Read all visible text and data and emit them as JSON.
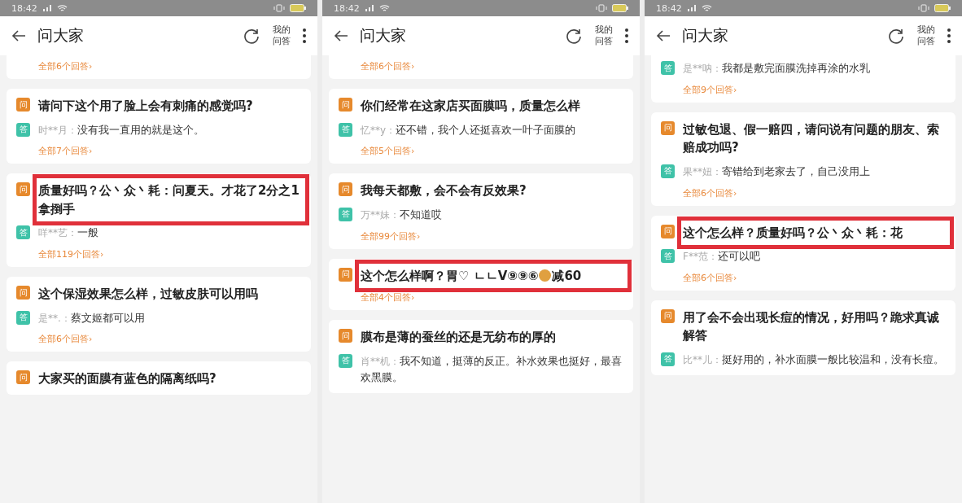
{
  "panels": [
    {
      "status_bar": {
        "time": "18:42"
      },
      "header": {
        "title": "问大家",
        "my_qa": "我的问答"
      },
      "cards": [
        {
          "more_link": "全部6个回答›"
        },
        {
          "question": {
            "badge": "问",
            "text": "请问下这个用了脸上会有刺痛的感觉吗?",
            "highlighted": false
          },
          "answers": [
            {
              "badge": "答",
              "user": "时**月：",
              "text": "没有我一直用的就是这个。"
            }
          ],
          "more_link": "全部7个回答›"
        },
        {
          "question": {
            "badge": "问",
            "text": "质量好吗？公丶众丶耗：问夏天。才花了2分之1拿捯手",
            "highlighted": true
          },
          "answers": [
            {
              "badge": "答",
              "user": "咩**艺：",
              "text": "一般"
            }
          ],
          "more_link": "全部119个回答›"
        },
        {
          "question": {
            "badge": "问",
            "text": "这个保湿效果怎么样，过敏皮肤可以用吗",
            "highlighted": false
          },
          "answers": [
            {
              "badge": "答",
              "user": "是**.：",
              "text": "蔡文姬都可以用"
            }
          ],
          "more_link": "全部6个回答›"
        },
        {
          "question": {
            "badge": "问",
            "text": "大家买的面膜有蓝色的隔离纸吗?",
            "highlighted": false
          }
        }
      ]
    },
    {
      "status_bar": {
        "time": "18:42"
      },
      "header": {
        "title": "问大家",
        "my_qa": "我的问答"
      },
      "cards": [
        {
          "more_link": "全部6个回答›"
        },
        {
          "question": {
            "badge": "问",
            "text": "你们经常在这家店买面膜吗，质量怎么样",
            "highlighted": false
          },
          "answers": [
            {
              "badge": "答",
              "user": "忆**y：",
              "text": "还不错，我个人还挺喜欢一叶子面膜的"
            }
          ],
          "more_link": "全部5个回答›"
        },
        {
          "question": {
            "badge": "问",
            "text": "我每天都敷，会不会有反效果?",
            "highlighted": false
          },
          "answers": [
            {
              "badge": "答",
              "user": "万**妹：",
              "text": "不知道哎"
            }
          ],
          "more_link": "全部99个回答›"
        },
        {
          "question": {
            "badge": "问",
            "text": "这个怎么样啊？胃♡ ㄴㄴV⑨⑨⑥",
            "coin_suffix": "减60",
            "highlighted": true
          },
          "more_link": "全部4个回答›"
        },
        {
          "question": {
            "badge": "问",
            "text": "膜布是薄的蚕丝的还是无纺布的厚的",
            "highlighted": false
          },
          "answers": [
            {
              "badge": "答",
              "user": "肖**机：",
              "text": "我不知道，挺薄的反正。补水效果也挺好，最喜欢黑膜。"
            }
          ]
        }
      ]
    },
    {
      "status_bar": {
        "time": "18:42"
      },
      "header": {
        "title": "问大家",
        "my_qa": "我的问答"
      },
      "cards": [
        {
          "answers": [
            {
              "badge": "答",
              "user": "是**呐：",
              "text": "我都是敷完面膜洗掉再涂的水乳"
            }
          ],
          "more_link": "全部9个回答›"
        },
        {
          "question": {
            "badge": "问",
            "text": "过敏包退、假一赔四，请问说有问题的朋友、索赔成功吗?",
            "highlighted": false
          },
          "answers": [
            {
              "badge": "答",
              "user": "果**妞：",
              "text": "寄错给到老家去了，自己没用上"
            }
          ],
          "more_link": "全部6个回答›"
        },
        {
          "question": {
            "badge": "问",
            "text": "这个怎么样？质量好吗？公丶众丶耗：花",
            "highlighted": true
          },
          "answers": [
            {
              "badge": "答",
              "user": "F**范：",
              "text": "还可以吧"
            }
          ],
          "more_link": "全部6个回答›"
        },
        {
          "question": {
            "badge": "问",
            "text": "用了会不会出现长痘的情况，好用吗？跪求真诚解答",
            "highlighted": false
          },
          "answers": [
            {
              "badge": "答",
              "user": "比**儿：",
              "text": "挺好用的，补水面膜一般比较温和，没有长痘。"
            }
          ]
        }
      ]
    }
  ]
}
